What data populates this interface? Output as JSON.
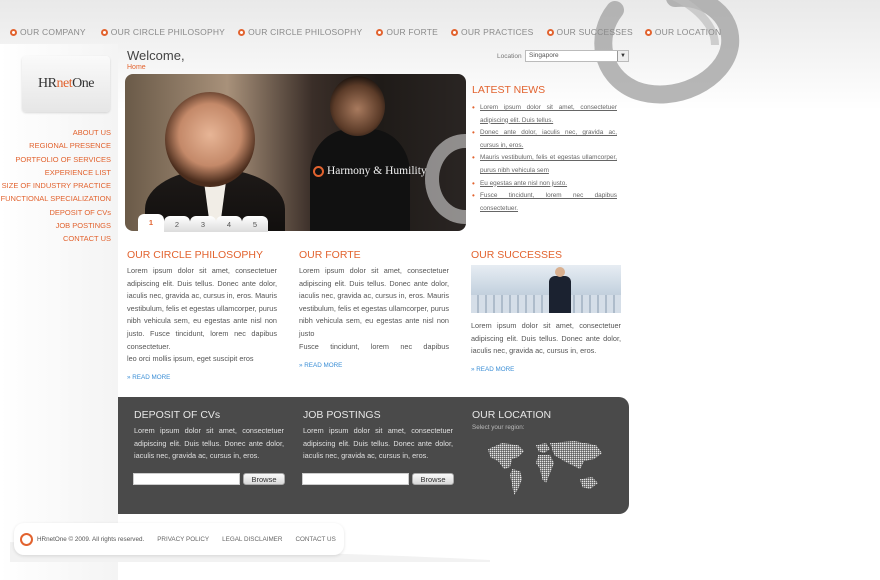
{
  "brand": {
    "logo_prefix": "HR",
    "logo_mid": "net",
    "logo_suffix": "One",
    "accent_color": "#e2632f"
  },
  "top_nav": [
    {
      "label": "OUR COMPANY"
    },
    {
      "label": "OUR CIRCLE PHILOSOPHY"
    },
    {
      "label": "OUR CIRCLE PHILOSOPHY"
    },
    {
      "label": "OUR FORTE"
    },
    {
      "label": "OUR PRACTICES"
    },
    {
      "label": "OUR SUCCESSES"
    },
    {
      "label": "OUR LOCATION"
    }
  ],
  "left_nav": [
    {
      "label": "ABOUT US"
    },
    {
      "label": "REGIONAL PRESENCE"
    },
    {
      "label": "PORTFOLIO OF SERVICES"
    },
    {
      "label": "EXPERIENCE LIST"
    },
    {
      "label": "SIZE OF INDUSTRY PRACTICE"
    },
    {
      "label": "FUNCTIONAL SPECIALIZATION"
    },
    {
      "label": "DEPOSIT OF CVs"
    },
    {
      "label": "JOB POSTINGS"
    },
    {
      "label": "CONTACT US"
    }
  ],
  "header": {
    "welcome": "Welcome,",
    "breadcrumb": "Home",
    "location_label": "Location",
    "location_value": "Singapore"
  },
  "hero": {
    "caption": "Harmony & Humility",
    "pages": [
      "1",
      "2",
      "3",
      "4",
      "5"
    ],
    "active_page": "1"
  },
  "news": {
    "title": "LATEST NEWS",
    "items": [
      "Lorem ipsum dolor sit amet, consectetuer adipiscing elit. Duis tellus.",
      "Donec ante dolor, iaculis nec, gravida ac, cursus in, eros.",
      "Mauris vestibulum, felis et egestas ullamcorper, purus nibh vehicula sem",
      "Eu egestas ante nisl non justo.",
      "Fusce tincidunt, lorem nec dapibus consectetuer."
    ]
  },
  "columns": {
    "philosophy": {
      "title": "OUR CIRCLE PHILOSOPHY",
      "text": "Lorem ipsum dolor sit amet, consectetuer adipiscing elit. Duis tellus. Donec ante dolor, iaculis nec, gravida ac, cursus in, eros. Mauris vestibulum, felis et egestas ullamcorper, purus nibh vehicula sem, eu egestas ante nisl non justo. Fusce tincidunt, lorem nec dapibus consectetuer.",
      "text2": "leo orci mollis ipsum, eget suscipit eros",
      "more": "» READ MORE"
    },
    "forte": {
      "title": "OUR FORTE",
      "text": "Lorem ipsum dolor sit amet, consectetuer adipiscing elit. Duis tellus. Donec ante dolor, iaculis nec, gravida ac, cursus in, eros. Mauris vestibulum, felis et egestas ullamcorper, purus nibh vehicula sem, eu egestas ante nisl non justo",
      "text2": "Fusce tincidunt, lorem nec dapibus",
      "more": "» READ MORE"
    },
    "successes": {
      "title": "OUR SUCCESSES",
      "text": "Lorem ipsum dolor sit amet, consectetuer adipiscing elit. Duis tellus. Donec ante dolor, iaculis nec, gravida ac, cursus in, eros.",
      "more": "» READ MORE"
    }
  },
  "dark_panel": {
    "deposit": {
      "title": "DEPOSIT OF CVs",
      "text": "Lorem ipsum dolor sit amet, consectetuer adipiscing elit. Duis tellus. Donec ante dolor, iaculis nec, gravida ac, cursus in, eros.",
      "input_value": "",
      "button": "Browse"
    },
    "jobs": {
      "title": "JOB POSTINGS",
      "text": "Lorem ipsum dolor sit amet, consectetuer adipiscing elit. Duis tellus. Donec ante dolor, iaculis nec, gravida ac, cursus in, eros.",
      "input_value": "",
      "button": "Browse"
    },
    "location": {
      "title": "OUR LOCATION",
      "subtitle": "Select your region:"
    }
  },
  "footer": {
    "copyright": "HRnetOne © 2009. All rights reserved.",
    "links": [
      "PRIVACY POLICY",
      "LEGAL DISCLAIMER",
      "CONTACT US"
    ]
  }
}
